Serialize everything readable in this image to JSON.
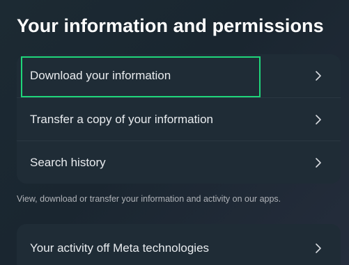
{
  "page": {
    "title": "Your information and permissions"
  },
  "main_list": {
    "items": [
      {
        "label": "Download your information",
        "icon": "chevron-right-icon"
      },
      {
        "label": "Transfer a copy of your information",
        "icon": "chevron-right-icon"
      },
      {
        "label": "Search history",
        "icon": "chevron-right-icon"
      }
    ]
  },
  "helper": {
    "text": "View, download or transfer your information and activity on our apps."
  },
  "second_list": {
    "items": [
      {
        "label": "Your activity off Meta technologies",
        "icon": "chevron-right-icon"
      }
    ]
  },
  "colors": {
    "highlight": "#1fd67a",
    "card": "#1f2c36",
    "text": "#e9ecef",
    "muted": "#b0b3b8"
  }
}
